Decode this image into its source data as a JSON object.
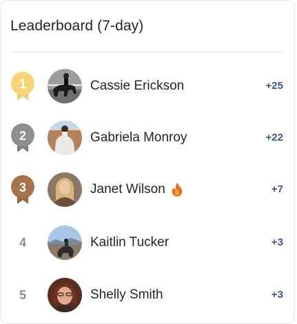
{
  "widget": {
    "title": "Leaderboard (7-day)"
  },
  "colors": {
    "gold": "#f2cd6f",
    "silver": "#8e8e8e",
    "bronze": "#a8734c",
    "score": "#3d548c",
    "fire": "#f06a1d"
  },
  "entries": [
    {
      "rank": "1",
      "name": "Cassie Erickson",
      "score": "+25",
      "badge": "gold-ribbon-icon"
    },
    {
      "rank": "2",
      "name": "Gabriela Monroy",
      "score": "+22",
      "badge": "silver-ribbon-icon"
    },
    {
      "rank": "3",
      "name": "Janet Wilson",
      "score": "+7",
      "badge": "bronze-ribbon-icon",
      "extra_icon": "fire-icon"
    },
    {
      "rank": "4",
      "name": "Kaitlin Tucker",
      "score": "+3"
    },
    {
      "rank": "5",
      "name": "Shelly Smith",
      "score": "+3"
    }
  ]
}
